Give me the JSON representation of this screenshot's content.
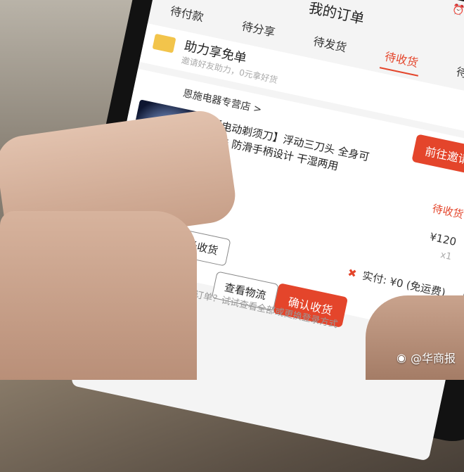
{
  "topbar": {
    "title": "我的订单",
    "back": "<"
  },
  "tabs": [
    {
      "label": "待付款",
      "active": false
    },
    {
      "label": "待分享",
      "active": false
    },
    {
      "label": "待发货",
      "active": false
    },
    {
      "label": "待收货",
      "active": true
    },
    {
      "label": "待评价",
      "active": false
    }
  ],
  "promo": {
    "title": "助力享免单",
    "subtitle": "邀请好友助力，0元拿好货"
  },
  "order": {
    "shop_name": "恩施电器专营店 >",
    "invite_button": "前往邀请",
    "product_title": "【电动剃须刀】浮动三刀头 全身可水洗 防滑手柄设计 干湿两用",
    "status": "待收货",
    "price": "¥120",
    "quantity": "x1",
    "paid_text": "实付: ¥0 (免运费)",
    "extend_button": "延长收货",
    "track_button": "查看物流",
    "confirm_button": "确认收货"
  },
  "hint": "没找到订单？试试查看全部或更换登录方式",
  "watermark": "@华商报",
  "colors": {
    "accent": "#e4452b",
    "promo_icon": "#f2c44b"
  }
}
